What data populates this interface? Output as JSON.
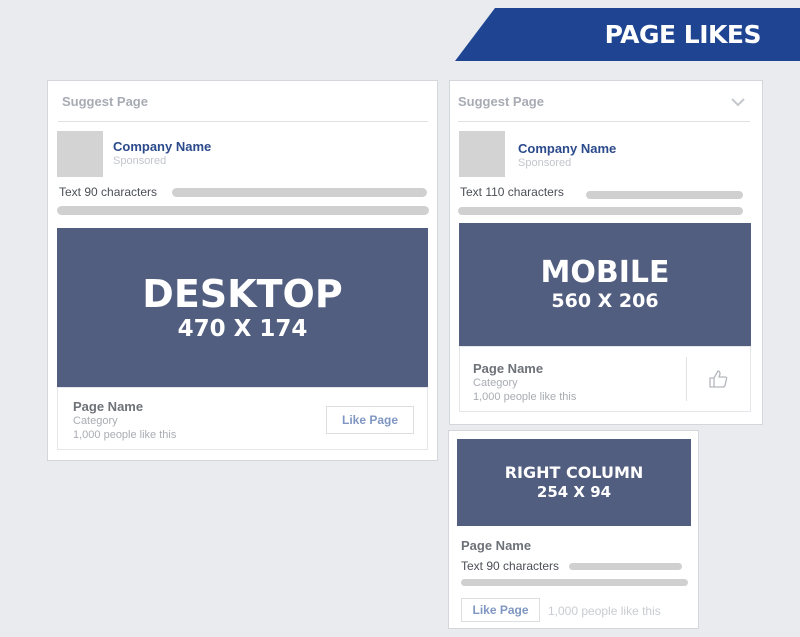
{
  "banner": {
    "title": "PAGE LIKES"
  },
  "desktop": {
    "suggest_label": "Suggest Page",
    "company_name": "Company Name",
    "sponsored": "Sponsored",
    "text_label": "Text 90 characters",
    "hero_title": "DESKTOP",
    "hero_size": "470 X 174",
    "page_name": "Page Name",
    "category": "Category",
    "likes": "1,000 people like this",
    "like_button": "Like Page"
  },
  "mobile": {
    "suggest_label": "Suggest Page",
    "company_name": "Company Name",
    "sponsored": "Sponsored",
    "text_label": "Text 110 characters",
    "hero_title": "MOBILE",
    "hero_size": "560 X 206",
    "page_name": "Page Name",
    "category": "Category",
    "likes": "1,000 people like this"
  },
  "right_column": {
    "hero_title": "RIGHT COLUMN",
    "hero_size": "254 X 94",
    "page_name": "Page Name",
    "text_label": "Text 90 characters",
    "like_button": "Like Page",
    "likes": "1,000 people like this"
  },
  "colors": {
    "banner": "#1f4592",
    "hero": "#525e80",
    "company_name": "#2b4a8b",
    "like_button_text": "#7f97c2"
  }
}
